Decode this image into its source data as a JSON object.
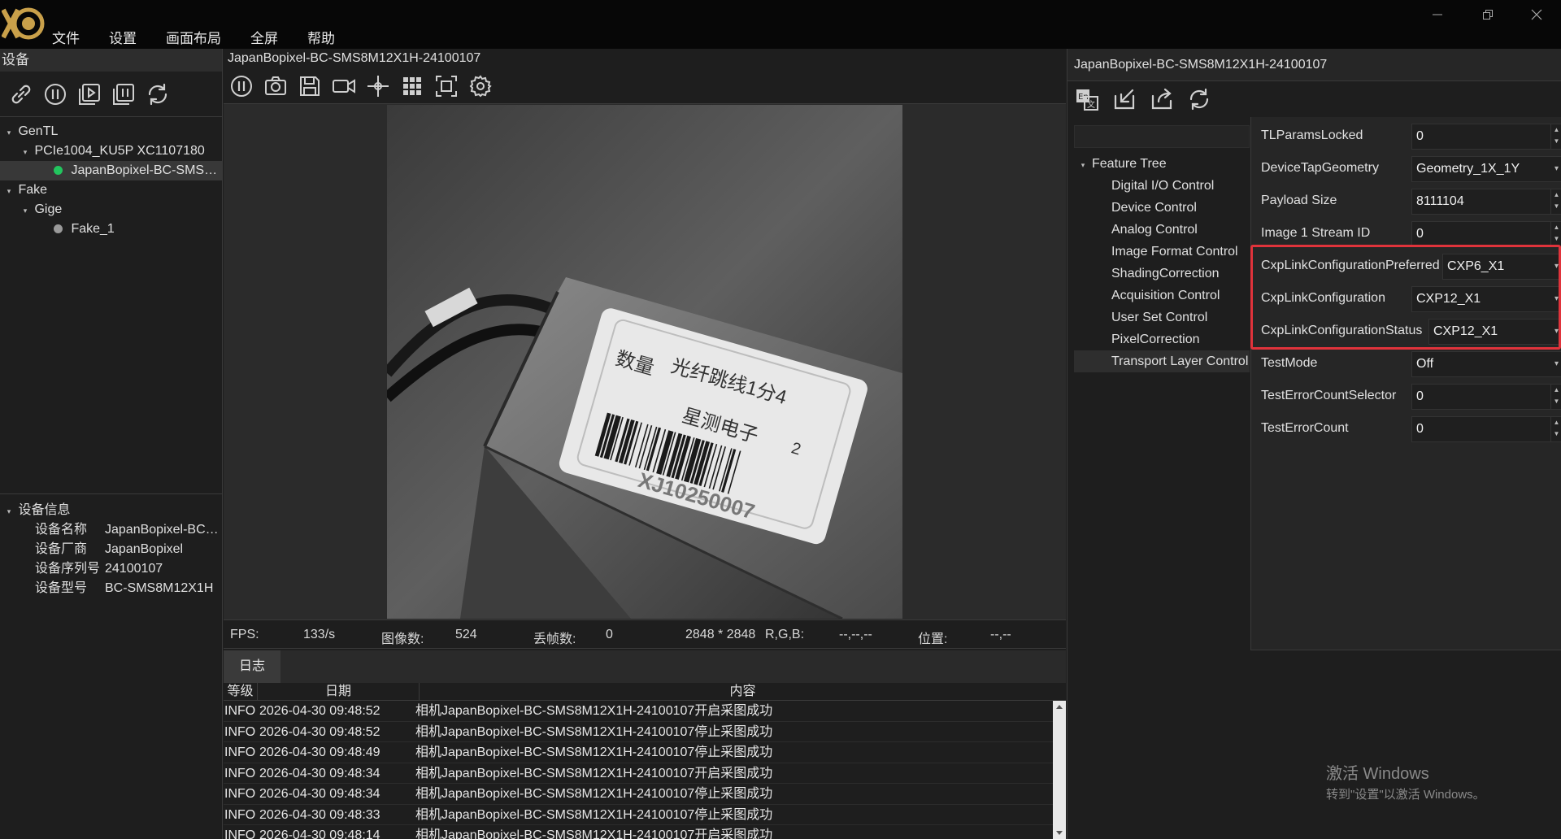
{
  "app": {
    "logo_text": "XG"
  },
  "menu": [
    "文件",
    "设置",
    "画面布局",
    "全屏",
    "帮助"
  ],
  "window_controls": {
    "minimize": "—",
    "restore": "❐",
    "close": "✕"
  },
  "left": {
    "title": "设备",
    "tree": [
      {
        "label": "GenTL",
        "level": 0,
        "caret": "▾"
      },
      {
        "label": "PCIe1004_KU5P XC1107180",
        "level": 1,
        "caret": "▾"
      },
      {
        "label": "JapanBopixel-BC-SMS…",
        "level": 2,
        "status": "online"
      },
      {
        "label": "Fake",
        "level": 0,
        "caret": "▾"
      },
      {
        "label": "Gige",
        "level": 1,
        "caret": "▾"
      },
      {
        "label": "Fake_1",
        "level": 2,
        "status": "offline"
      }
    ],
    "info_title": "设备信息",
    "info": [
      {
        "key": "设备名称",
        "value": "JapanBopixel-BC…"
      },
      {
        "key": "设备厂商",
        "value": "JapanBopixel"
      },
      {
        "key": "设备序列号",
        "value": "24100107"
      },
      {
        "key": "设备型号",
        "value": "BC-SMS8M12X1H"
      }
    ],
    "colors": {
      "online": "#22c55e",
      "offline": "#9a9a9a"
    }
  },
  "view": {
    "title": "JapanBopixel-BC-SMS8M12X1H-24100107",
    "image": {
      "label_line1": "光纤跳线1分4",
      "label_qty": "数量",
      "label_line2": "星测电子",
      "label_count": "2",
      "barcode_text": "XJ10250007"
    },
    "status": {
      "fps_label": "FPS:",
      "fps_value": "133/s",
      "frames_label": "图像数:",
      "frames_value": "524",
      "dropped_label": "丢帧数:",
      "dropped_value": "0",
      "resolution": "2848 * 2848",
      "rgb_label": "R,G,B:",
      "rgb_value": "--,--,--",
      "pos_label": "位置:",
      "pos_value": "--,--"
    }
  },
  "log": {
    "tab": "日志",
    "headers": [
      "等级",
      "日期",
      "内容"
    ],
    "rows": [
      {
        "level": "INFO",
        "date": "2026-04-30 09:48:52",
        "msg": "相机JapanBopixel-BC-SMS8M12X1H-24100107开启采图成功"
      },
      {
        "level": "INFO",
        "date": "2026-04-30 09:48:52",
        "msg": "相机JapanBopixel-BC-SMS8M12X1H-24100107停止采图成功"
      },
      {
        "level": "INFO",
        "date": "2026-04-30 09:48:49",
        "msg": "相机JapanBopixel-BC-SMS8M12X1H-24100107停止采图成功"
      },
      {
        "level": "INFO",
        "date": "2026-04-30 09:48:34",
        "msg": "相机JapanBopixel-BC-SMS8M12X1H-24100107开启采图成功"
      },
      {
        "level": "INFO",
        "date": "2026-04-30 09:48:34",
        "msg": "相机JapanBopixel-BC-SMS8M12X1H-24100107停止采图成功"
      },
      {
        "level": "INFO",
        "date": "2026-04-30 09:48:33",
        "msg": "相机JapanBopixel-BC-SMS8M12X1H-24100107停止采图成功"
      },
      {
        "level": "INFO",
        "date": "2026-04-30 09:48:14",
        "msg": "相机JapanBopixel-BC-SMS8M12X1H-24100107开启采图成功"
      }
    ]
  },
  "right": {
    "title": "JapanBopixel-BC-SMS8M12X1H-24100107",
    "feature_tree": {
      "root": "Feature Tree",
      "items": [
        "Digital I/O Control",
        "Device Control",
        "Analog Control",
        "Image Format Control",
        "ShadingCorrection",
        "Acquisition Control",
        "User Set Control",
        "PixelCorrection",
        "Transport Layer Control"
      ],
      "selected": "Transport Layer Control"
    },
    "properties": [
      {
        "name": "TLParamsLocked",
        "value": "0",
        "kind": "spin"
      },
      {
        "name": "DeviceTapGeometry",
        "value": "Geometry_1X_1Y",
        "kind": "combo"
      },
      {
        "name": "Payload Size",
        "value": "8111104",
        "kind": "spin"
      },
      {
        "name": "Image 1 Stream ID",
        "value": "0",
        "kind": "spin"
      },
      {
        "name": "CxpLinkConfigurationPreferred",
        "value": "CXP6_X1",
        "kind": "combo"
      },
      {
        "name": "CxpLinkConfiguration",
        "value": "CXP12_X1",
        "kind": "combo"
      },
      {
        "name": "CxpLinkConfigurationStatus",
        "value": "CXP12_X1",
        "kind": "combo"
      },
      {
        "name": "TestMode",
        "value": "Off",
        "kind": "combo"
      },
      {
        "name": "TestErrorCountSelector",
        "value": "0",
        "kind": "spin"
      },
      {
        "name": "TestErrorCount",
        "value": "0",
        "kind": "spin"
      }
    ],
    "highlight_color": "#e0333b"
  },
  "watermark": {
    "title": "激活 Windows",
    "subtitle": "转到\"设置\"以激活 Windows。"
  }
}
